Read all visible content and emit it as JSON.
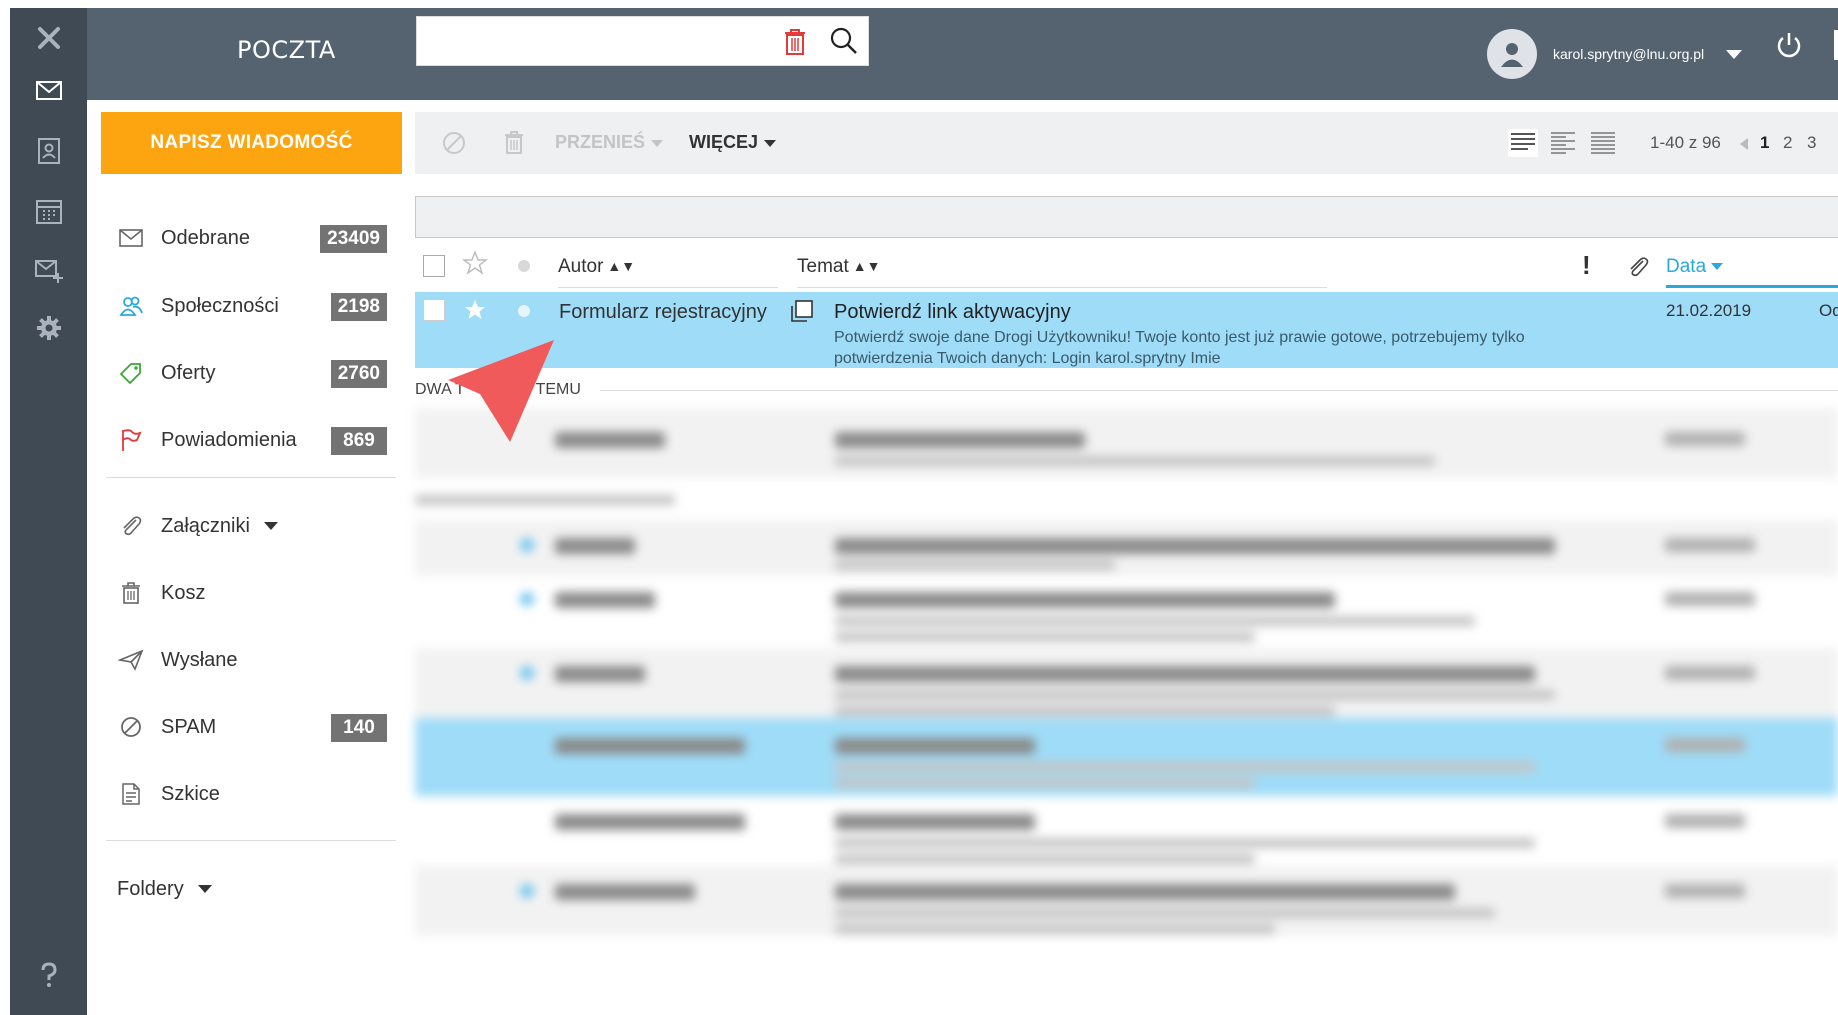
{
  "app": {
    "title": "POCZTA"
  },
  "search": {
    "placeholder": ""
  },
  "user": {
    "email": "karol.sprytny@lnu.org.pl"
  },
  "sidebar": {
    "compose_label": "NAPISZ WIADOMOŚĆ",
    "folders": [
      {
        "label": "Odebrane",
        "count": "23409",
        "icon": "envelope-icon"
      },
      {
        "label": "Społeczności",
        "count": "2198",
        "icon": "people-icon"
      },
      {
        "label": "Oferty",
        "count": "2760",
        "icon": "tag-icon"
      },
      {
        "label": "Powiadomienia",
        "count": "869",
        "icon": "flag-icon"
      }
    ],
    "others": [
      {
        "label": "Załączniki",
        "icon": "paperclip-icon"
      },
      {
        "label": "Kosz",
        "icon": "trash-icon"
      },
      {
        "label": "Wysłane",
        "icon": "send-icon"
      },
      {
        "label": "SPAM",
        "count": "140",
        "icon": "spam-icon"
      },
      {
        "label": "Szkice",
        "icon": "draft-icon"
      }
    ],
    "folders_label": "Foldery"
  },
  "toolbar": {
    "move_label": "PRZENIEŚ",
    "more_label": "WIĘCEJ",
    "page_info": "1-40 z 96",
    "pages": [
      "1",
      "2",
      "3"
    ]
  },
  "list_header": {
    "author": "Autor",
    "subject": "Temat",
    "important": "!",
    "date": "Data"
  },
  "selected_email": {
    "author": "Formularz rejestracyjny",
    "subject": "Potwierdź link aktywacyjny",
    "preview": "Potwierdź swoje dane Drogi Użytkowniku! Twoje konto jest już prawie gotowe, potrzebujemy tylko potwierdzenia Twoich danych: Login karol.sprytny Imie",
    "date": "21.02.2019",
    "cut_text": "Od"
  },
  "divider": {
    "label": "DWA T... E TEMU",
    "left": "DWA T",
    "right": "E TEMU"
  },
  "colors": {
    "rail": "#3f4a55",
    "topbar": "#556371",
    "compose": "#fca510",
    "selected_row": "#9fdcf8",
    "accent": "#29a9e0",
    "arrow": "#f05a5a"
  }
}
